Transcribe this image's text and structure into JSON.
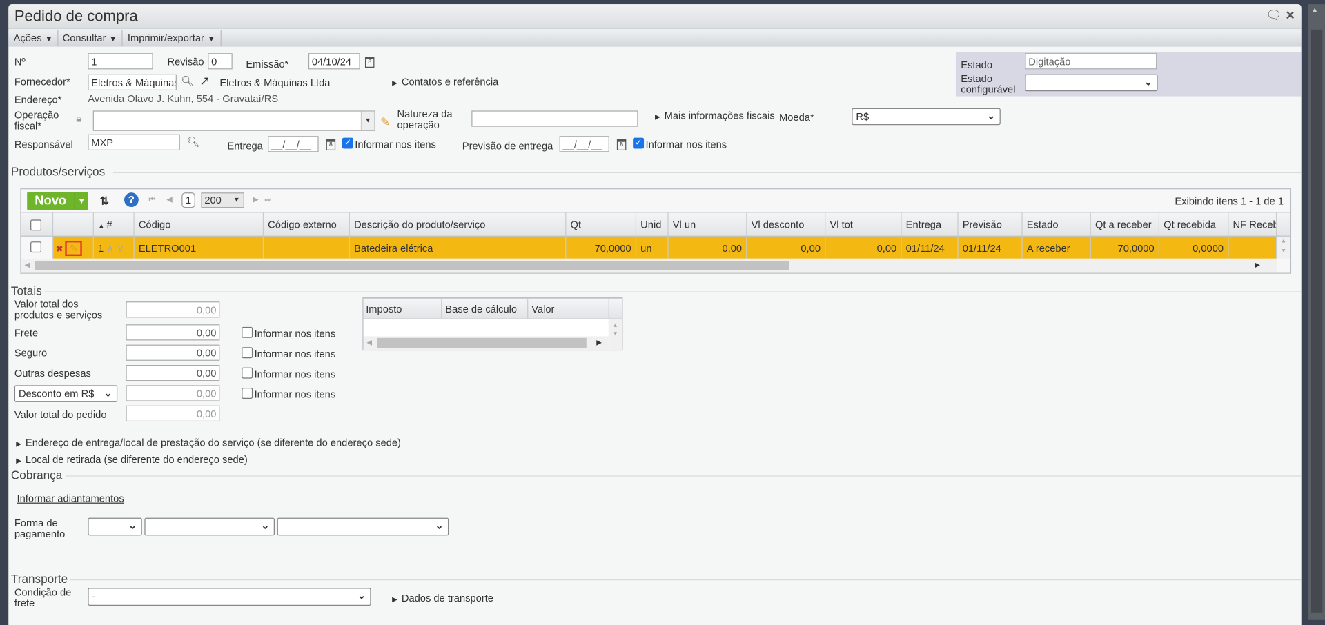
{
  "window": {
    "title": "Pedido de compra"
  },
  "toolbar": {
    "acoes": "Ações",
    "consultar": "Consultar",
    "imprimir": "Imprimir/exportar"
  },
  "form": {
    "numero_label": "Nº",
    "numero": "1",
    "revisao_label": "Revisão",
    "revisao": "0",
    "emissao_label": "Emissão*",
    "emissao": "04/10/24",
    "fornecedor_label": "Fornecedor*",
    "fornecedor": "Eletros & Máquinas",
    "fornecedor_nome": "Eletros & Máquinas Ltda",
    "contatos": "Contatos e referência",
    "endereco_label": "Endereço*",
    "endereco": "Avenida Olavo J. Kuhn, 554 - Gravataí/RS",
    "operacao_label_1": "Operação",
    "operacao_label_2": "fiscal*",
    "natureza_label_1": "Natureza da",
    "natureza_label_2": "operação",
    "mais_info": "Mais informações fiscais",
    "moeda_label": "Moeda*",
    "moeda": "R$",
    "responsavel_label": "Responsável",
    "responsavel": "MXP",
    "entrega_label": "Entrega",
    "entrega": "__/__/__",
    "informar_itens": "Informar nos itens",
    "previsao_label": "Previsão de entrega",
    "previsao": "__/__/__",
    "estado_label": "Estado",
    "estado": "Digitação",
    "estado_conf_1": "Estado",
    "estado_conf_2": "configurável"
  },
  "produtos": {
    "legend": "Produtos/serviços",
    "novo": "Novo",
    "page": "1",
    "page_size": "200",
    "showing": "Exibindo itens 1 - 1 de 1",
    "columns": [
      "#",
      "Código",
      "Código externo",
      "Descrição do produto/serviço",
      "Qt",
      "Unid",
      "Vl un",
      "Vl desconto",
      "Vl tot",
      "Entrega",
      "Previsão",
      "Estado",
      "Qt a receber",
      "Qt recebida",
      "NF Receb"
    ],
    "rows": [
      {
        "n": "1",
        "codigo": "ELETRO001",
        "externo": "",
        "descricao": "Batedeira elétrica",
        "qt": "70,0000",
        "unid": "un",
        "vl_un": "0,00",
        "vl_desc": "0,00",
        "vl_tot": "0,00",
        "entrega": "01/11/24",
        "previsao": "01/11/24",
        "estado": "A receber",
        "qt_receber": "70,0000",
        "qt_recebida": "0,0000",
        "nf": ""
      }
    ]
  },
  "totais": {
    "legend": "Totais",
    "valor_produtos_1": "Valor total dos",
    "valor_produtos_2": "produtos e serviços",
    "valor_produtos": "0,00",
    "frete_label": "Frete",
    "frete": "0,00",
    "seguro_label": "Seguro",
    "seguro": "0,00",
    "outras_label": "Outras despesas",
    "outras": "0,00",
    "desconto_tipo": "Desconto em R$",
    "desconto": "0,00",
    "valor_pedido_label": "Valor total do pedido",
    "valor_pedido": "0,00",
    "informar_itens": "Informar nos itens",
    "impostos_columns": [
      "Imposto",
      "Base de cálculo",
      "Valor"
    ]
  },
  "links": {
    "endereco_entrega": "Endereço de entrega/local de prestação do serviço (se diferente do endereço sede)",
    "local_retirada": "Local de retirada (se diferente do endereço sede)"
  },
  "cobranca": {
    "legend": "Cobrança",
    "adiantamentos": "Informar adiantamentos",
    "forma_1": "Forma de",
    "forma_2": "pagamento"
  },
  "transporte": {
    "legend": "Transporte",
    "condicao_1": "Condição de",
    "condicao_2": "frete",
    "condicao": "-",
    "dados": "Dados de transporte"
  }
}
